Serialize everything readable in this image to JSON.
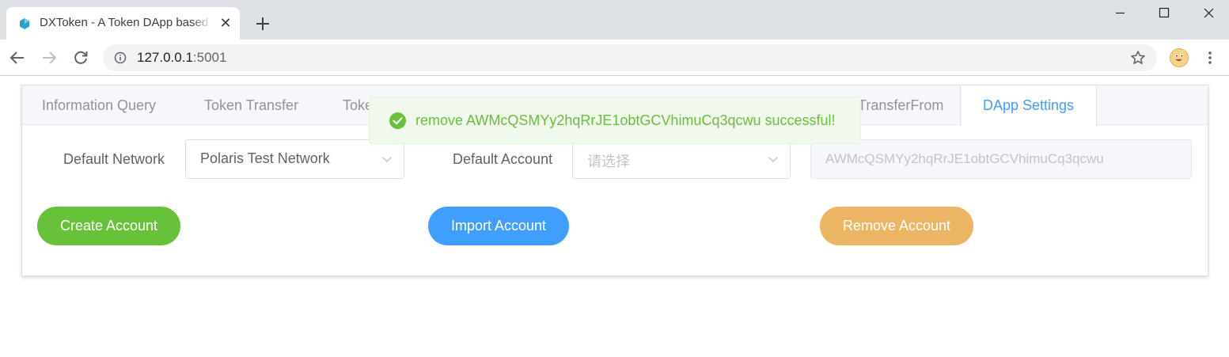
{
  "browser": {
    "tab_title": "DXToken - A Token DApp based on Neo",
    "tab_close": "✕",
    "url_host": "127.0.0.1",
    "url_port": ":5001"
  },
  "page": {
    "tabs": [
      {
        "label": "Information Query"
      },
      {
        "label": "Token Transfer"
      },
      {
        "label": "Toke"
      },
      {
        "label": "TransferFrom"
      },
      {
        "label": "DApp Settings"
      }
    ],
    "active_tab": "DApp Settings",
    "form": {
      "network_label": "Default Network",
      "network_value": "Polaris Test Network",
      "account_label": "Default Account",
      "account_placeholder": "请选择",
      "address_value": "AWMcQSMYy2hqRrJE1obtGCVhimuCq3qcwu"
    },
    "buttons": {
      "create": "Create Account",
      "import": "Import Account",
      "remove": "Remove Account"
    }
  },
  "toast": {
    "message": "remove AWMcQSMYy2hqRrJE1obtGCVhimuCq3qcwu successful!",
    "type": "success"
  },
  "colors": {
    "primary": "#409eff",
    "success": "#67c23a",
    "warning": "#ebb563",
    "chrome_bg": "#dee1e6"
  },
  "icons": [
    "favicon-icon",
    "close-icon",
    "plus-icon",
    "minimize-icon",
    "maximize-icon",
    "window-close-icon",
    "back-arrow-icon",
    "forward-arrow-icon",
    "reload-icon",
    "info-icon",
    "star-icon",
    "profile-avatar-icon",
    "menu-dots-icon",
    "chevron-down-icon",
    "check-circle-icon"
  ]
}
